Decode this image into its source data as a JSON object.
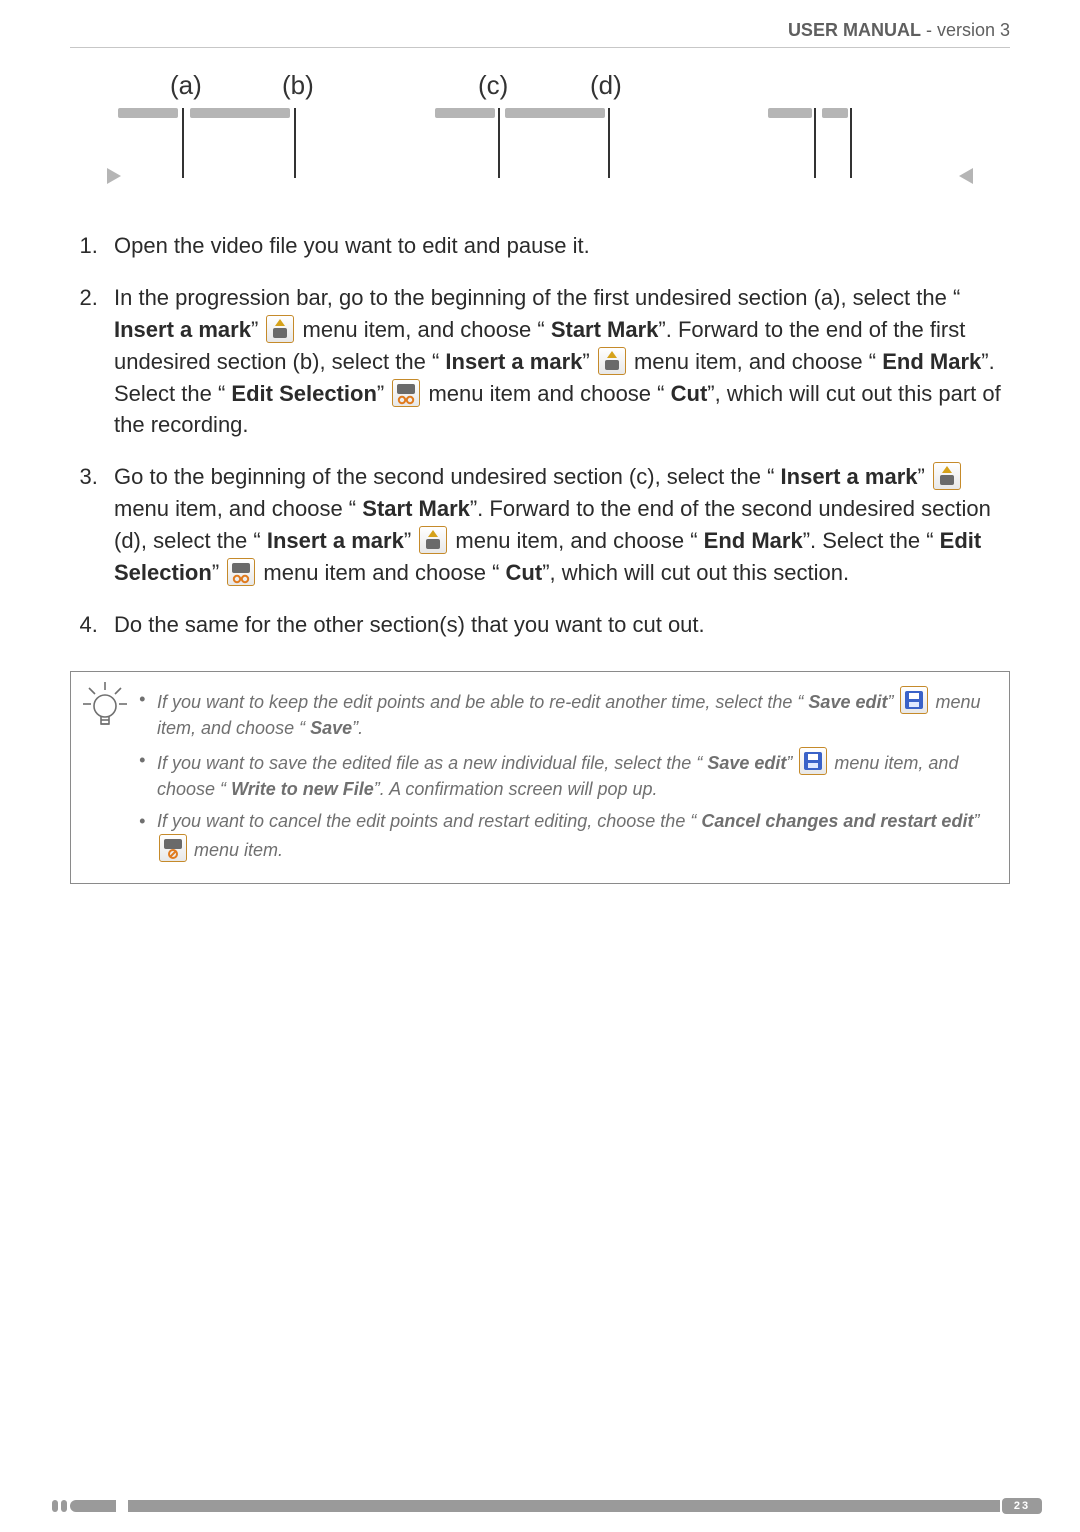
{
  "header": {
    "title_bold": "USER MANUAL",
    "title_rest": " - version 3"
  },
  "diagram": {
    "labels": [
      "(a)",
      "(b)",
      "(c)",
      "(d)"
    ]
  },
  "steps": [
    {
      "text": "Open the video file you want to edit and pause it."
    },
    {
      "p1": "In the progression bar, go to the beginning of the first undesired section (a), select the “",
      "insert_mark": "Insert a mark",
      "q": "” ",
      "p2": " menu item, and choose “",
      "start_mark": "Start Mark",
      "p3": "”. Forward to the end of the first undesired section (b), select the “",
      "p4": " menu item, and choose “",
      "end_mark": "End Mark",
      "p5": "”. Select the “",
      "edit_selection": "Edit Selection",
      "p6": " menu item and choose “",
      "cut": "Cut",
      "p7": "”, which will cut out this part of the recording."
    },
    {
      "p1": "Go to the beginning of the second undesired section (c), select the “",
      "insert_mark": "Insert a mark",
      "q": "” ",
      "p2": " menu item, and choose “",
      "start_mark": "Start Mark",
      "p3": "”. Forward to the end of the second undesired section (d), select the “",
      "p4": " menu item, and choose “",
      "end_mark": "End Mark",
      "p5": "”. Select the “",
      "edit_selection": "Edit Selection",
      "p6": " menu item and choose “",
      "cut": "Cut",
      "p7": "”, which will cut out this section."
    },
    {
      "text": "Do the same for the other section(s) that you want to cut out."
    }
  ],
  "tips": [
    {
      "p1": "If you want to keep the edit points and be able to re-edit another time, select the “",
      "save_edit": "Save edit",
      "q": "” ",
      "p2": " menu item, and choose “",
      "save": "Save",
      "p3": "”."
    },
    {
      "p1": "If you want to save the edited file as a new individual file, select the “",
      "save_edit": "Save edit",
      "q": "” ",
      "p2": " menu item, and choose “",
      "write_new": "Write to new File",
      "p3": "”. A confirmation screen will pop up."
    },
    {
      "p1": "If you want to cancel the edit points and restart editing, choose the “",
      "cancel": "Cancel changes and restart edit",
      "q": "” ",
      "p2": " menu item."
    }
  ],
  "footer": {
    "page": "23"
  }
}
